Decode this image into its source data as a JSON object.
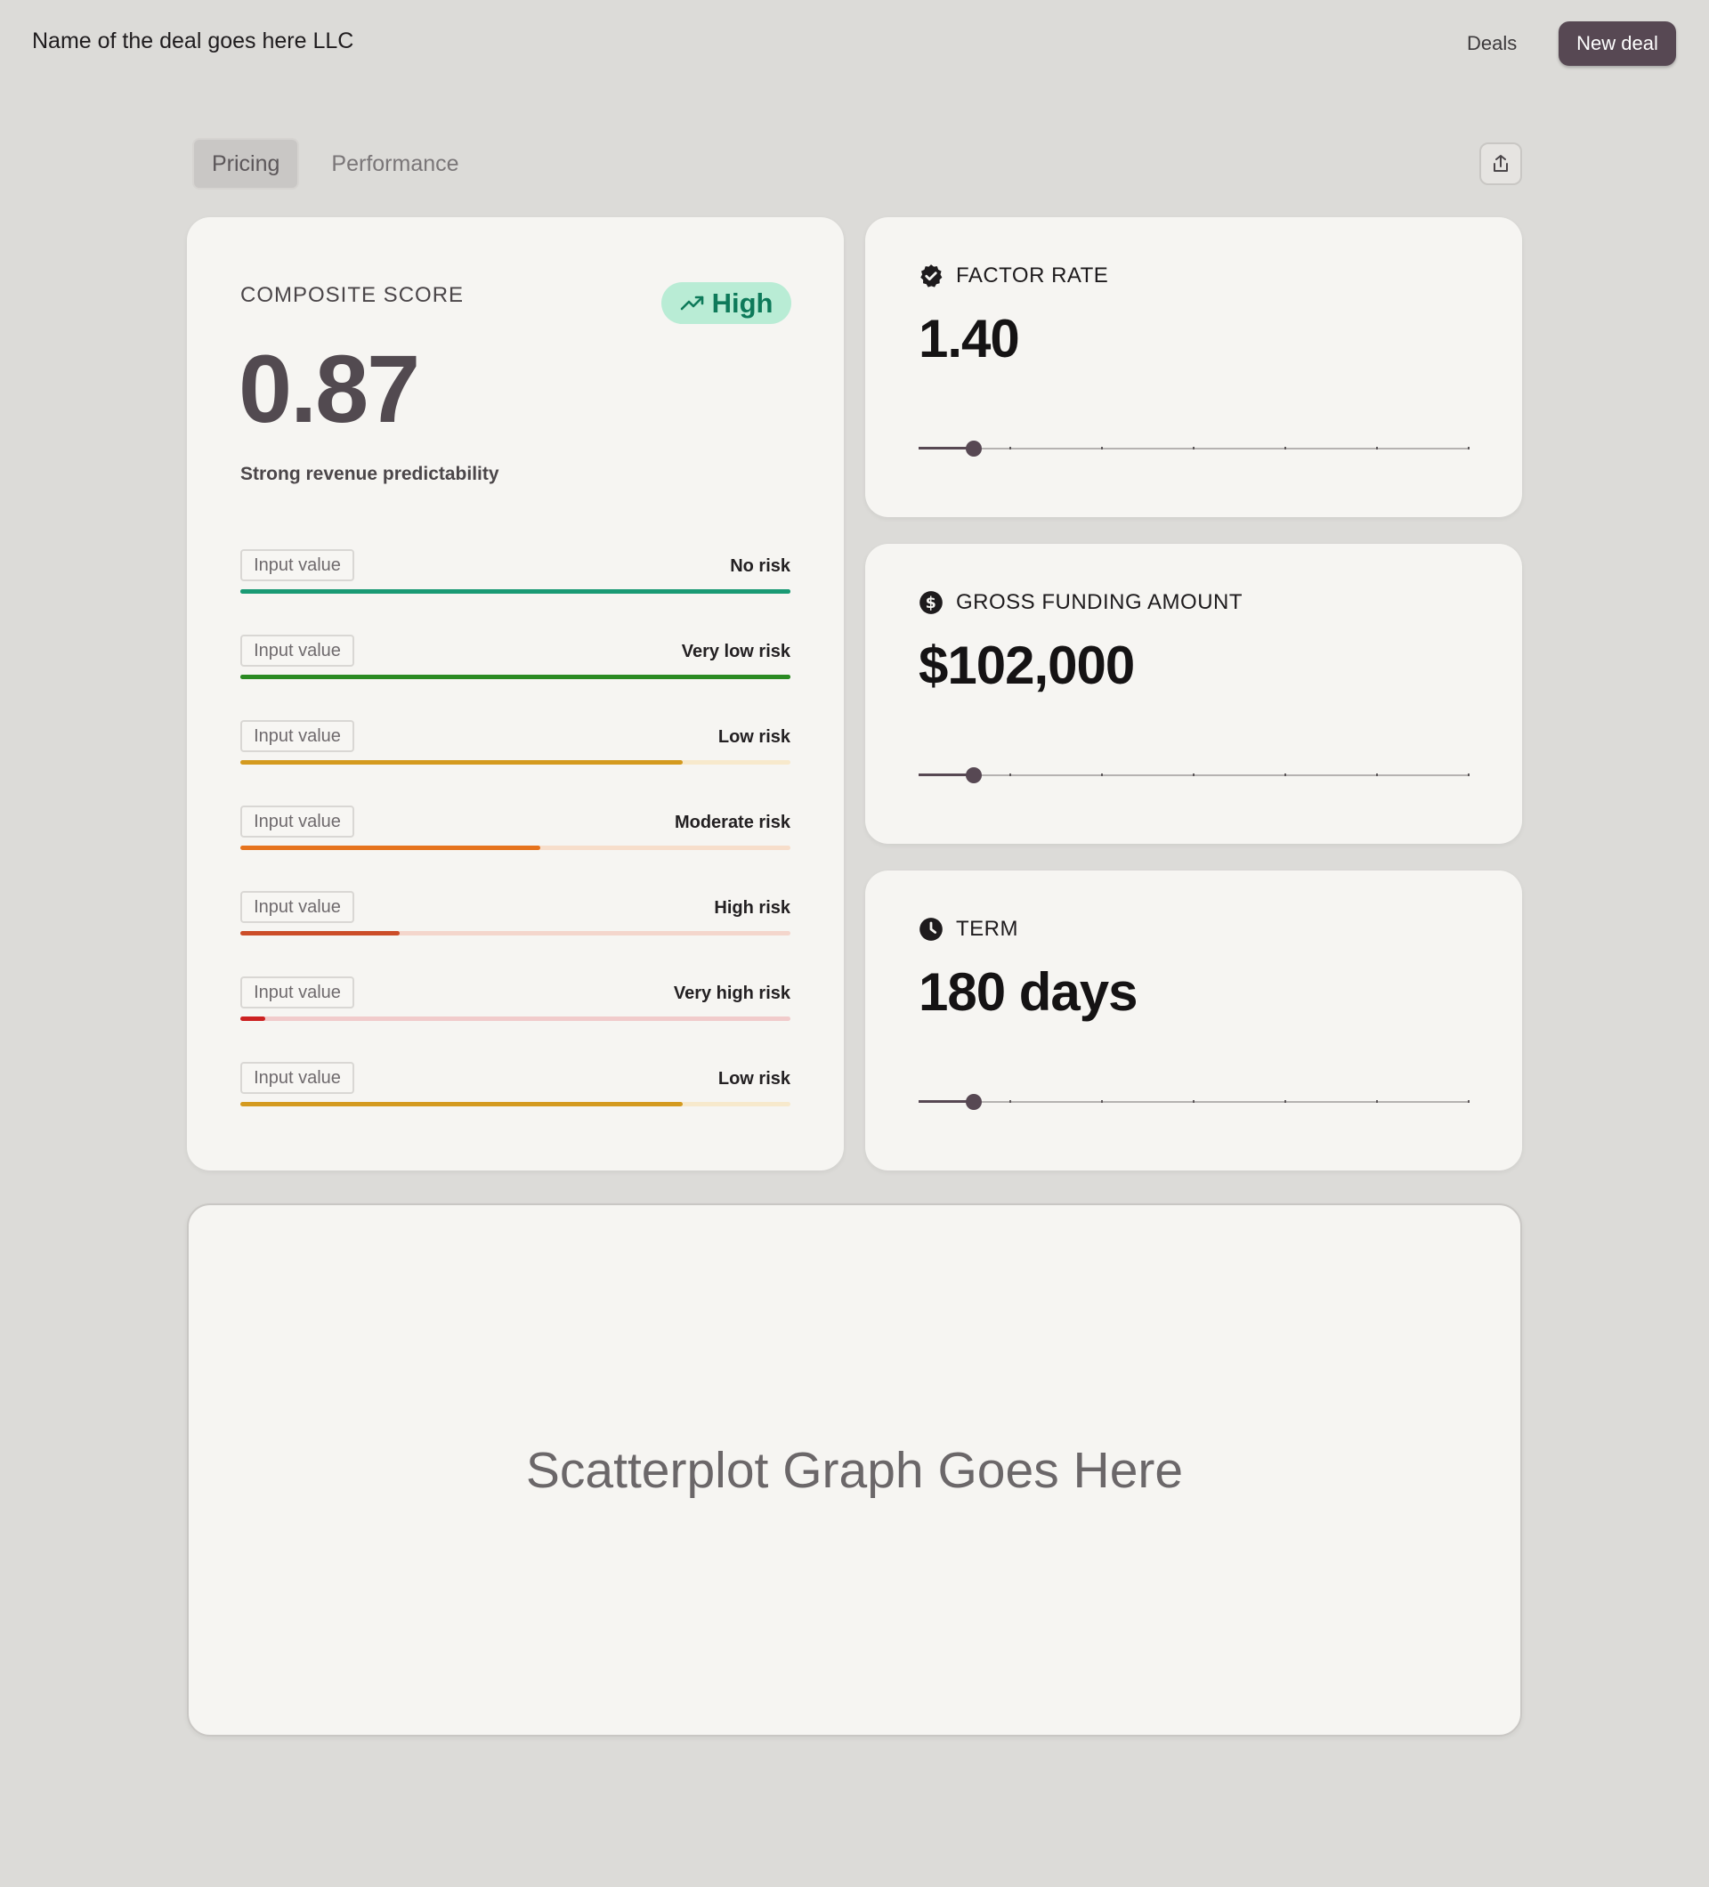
{
  "header": {
    "deal_name": "Name of the deal goes here LLC",
    "nav_deals": "Deals",
    "new_deal_label": "New deal",
    "accent": "#574853"
  },
  "tabs": [
    {
      "label": "Pricing",
      "active": true
    },
    {
      "label": "Performance",
      "active": false
    }
  ],
  "composite": {
    "label": "COMPOSITE SCORE",
    "badge": "High",
    "badge_icon": "trending-up-icon",
    "score": "0.87",
    "subtitle": "Strong revenue predictability",
    "rows": [
      {
        "input": "Input value",
        "label": "No risk",
        "level": 1.0,
        "color": "#1a9a74",
        "track": "#1a9a74"
      },
      {
        "input": "Input value",
        "label": "Very low risk",
        "level": 1.0,
        "color": "#2a8a22",
        "track": "#2a8a22"
      },
      {
        "input": "Input value",
        "label": "Low risk",
        "level": 0.805,
        "color": "#d49a1f",
        "track": "#f7e9cc"
      },
      {
        "input": "Input value",
        "label": "Moderate risk",
        "level": 0.545,
        "color": "#e6731d",
        "track": "#f7decb"
      },
      {
        "input": "Input value",
        "label": "High risk",
        "level": 0.29,
        "color": "#cc4d28",
        "track": "#f4d6cc"
      },
      {
        "input": "Input value",
        "label": "Very high risk",
        "level": 0.045,
        "color": "#cc2121",
        "track": "#f1cbcb"
      },
      {
        "input": "Input value",
        "label": "Low risk",
        "level": 0.805,
        "color": "#d49a1f",
        "track": "#f7e9cc"
      }
    ]
  },
  "metrics": [
    {
      "label": "FACTOR RATE",
      "icon": "verified-check-icon",
      "value": "1.40",
      "slider": 0.1
    },
    {
      "label": "GROSS FUNDING AMOUNT",
      "icon": "dollar-circle-icon",
      "value": "$102,000",
      "slider": 0.1
    },
    {
      "label": "TERM",
      "icon": "clock-icon",
      "value": "180 days",
      "slider": 0.1
    }
  ],
  "scatter": {
    "placeholder": "Scatterplot Graph Goes Here"
  }
}
